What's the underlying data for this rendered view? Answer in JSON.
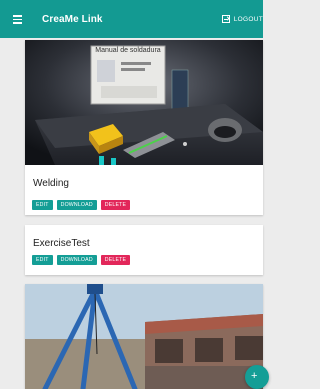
{
  "app": {
    "title": "CreaMe Link",
    "accent": "#149e96",
    "danger": "#e2275a"
  },
  "header": {
    "menu_icon": "hamburger-icon",
    "logout_label": "LOGOUT",
    "logout_icon": "logout-icon"
  },
  "cards": [
    {
      "title": "Welding",
      "edit_label": "EDIT",
      "download_label": "DOWNLOAD",
      "delete_label": "DELETE",
      "image": {
        "board_text": "Manual de soldadura"
      }
    },
    {
      "title": "ExerciseTest",
      "edit_label": "EDIT",
      "download_label": "DOWNLOAD",
      "delete_label": "DELETE"
    },
    {
      "title": "",
      "image": {
        "scene": "industrial"
      }
    }
  ],
  "fab": {
    "label": "+",
    "icon": "add-icon"
  }
}
